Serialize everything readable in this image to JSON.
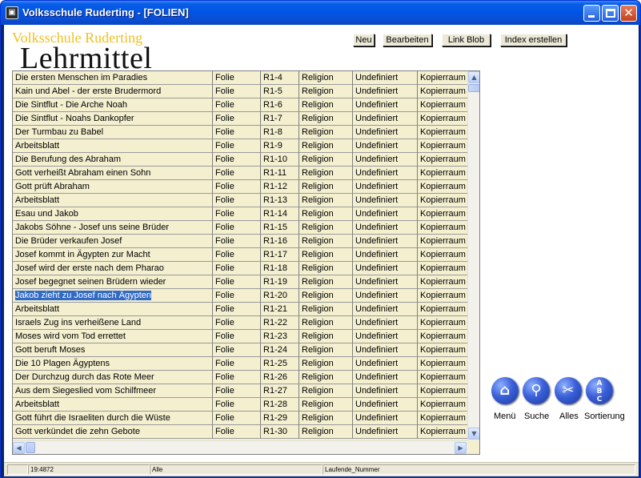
{
  "window": {
    "title": "Volksschule Ruderting - [FOLIEN]",
    "app_icon": "access-form-icon"
  },
  "brand": {
    "school": "Volksschule Ruderting",
    "heading": "Lehrmittel"
  },
  "toolbar": {
    "new_label": "Neu",
    "edit_label": "Bearbeiten",
    "link_blob_label": "Link Blob",
    "index_label": "Index erstellen"
  },
  "rows": [
    [
      "Die ersten Menschen im Paradies",
      "Folie",
      "R1-4",
      "Religion",
      "Undefiniert",
      "Kopierraum"
    ],
    [
      "Kain und Abel - der erste Brudermord",
      "Folie",
      "R1-5",
      "Religion",
      "Undefiniert",
      "Kopierraum"
    ],
    [
      "Die Sintflut - Die Arche Noah",
      "Folie",
      "R1-6",
      "Religion",
      "Undefiniert",
      "Kopierraum"
    ],
    [
      "Die Sintflut - Noahs Dankopfer",
      "Folie",
      "R1-7",
      "Religion",
      "Undefiniert",
      "Kopierraum"
    ],
    [
      "Der Turmbau zu Babel",
      "Folie",
      "R1-8",
      "Religion",
      "Undefiniert",
      "Kopierraum"
    ],
    [
      "Arbeitsblatt",
      "Folie",
      "R1-9",
      "Religion",
      "Undefiniert",
      "Kopierraum"
    ],
    [
      "Die Berufung des Abraham",
      "Folie",
      "R1-10",
      "Religion",
      "Undefiniert",
      "Kopierraum"
    ],
    [
      "Gott verheißt Abraham einen Sohn",
      "Folie",
      "R1-11",
      "Religion",
      "Undefiniert",
      "Kopierraum"
    ],
    [
      "Gott prüft Abraham",
      "Folie",
      "R1-12",
      "Religion",
      "Undefiniert",
      "Kopierraum"
    ],
    [
      "Arbeitsblatt",
      "Folie",
      "R1-13",
      "Religion",
      "Undefiniert",
      "Kopierraum"
    ],
    [
      "Esau und Jakob",
      "Folie",
      "R1-14",
      "Religion",
      "Undefiniert",
      "Kopierraum"
    ],
    [
      "Jakobs Söhne - Josef uns seine Brüder",
      "Folie",
      "R1-15",
      "Religion",
      "Undefiniert",
      "Kopierraum"
    ],
    [
      "Die Brüder verkaufen Josef",
      "Folie",
      "R1-16",
      "Religion",
      "Undefiniert",
      "Kopierraum"
    ],
    [
      "Josef kommt in Ägypten zur Macht",
      "Folie",
      "R1-17",
      "Religion",
      "Undefiniert",
      "Kopierraum"
    ],
    [
      "Josef wird der erste nach dem Pharao",
      "Folie",
      "R1-18",
      "Religion",
      "Undefiniert",
      "Kopierraum"
    ],
    [
      "Josef begegnet seinen Brüdern wieder",
      "Folie",
      "R1-19",
      "Religion",
      "Undefiniert",
      "Kopierraum"
    ],
    [
      "Jakob zieht zu Josef nach Ägypten",
      "Folie",
      "R1-20",
      "Religion",
      "Undefiniert",
      "Kopierraum"
    ],
    [
      "Arbeitsblatt",
      "Folie",
      "R1-21",
      "Religion",
      "Undefiniert",
      "Kopierraum"
    ],
    [
      "Israels Zug ins verheißene Land",
      "Folie",
      "R1-22",
      "Religion",
      "Undefiniert",
      "Kopierraum"
    ],
    [
      "Moses wird vom Tod errettet",
      "Folie",
      "R1-23",
      "Religion",
      "Undefiniert",
      "Kopierraum"
    ],
    [
      "Gott beruft Moses",
      "Folie",
      "R1-24",
      "Religion",
      "Undefiniert",
      "Kopierraum"
    ],
    [
      "Die 10 Plagen Ägyptens",
      "Folie",
      "R1-25",
      "Religion",
      "Undefiniert",
      "Kopierraum"
    ],
    [
      "Der Durchzug durch das Rote Meer",
      "Folie",
      "R1-26",
      "Religion",
      "Undefiniert",
      "Kopierraum"
    ],
    [
      "Aus dem Siegeslied vom Schilfmeer",
      "Folie",
      "R1-27",
      "Religion",
      "Undefiniert",
      "Kopierraum"
    ],
    [
      "Arbeitsblatt",
      "Folie",
      "R1-28",
      "Religion",
      "Undefiniert",
      "Kopierraum"
    ],
    [
      "Gott führt die Israeliten durch die Wüste",
      "Folie",
      "R1-29",
      "Religion",
      "Undefiniert",
      "Kopierraum"
    ],
    [
      "Gott verkündet die zehn Gebote",
      "Folie",
      "R1-30",
      "Religion",
      "Undefiniert",
      "Kopierraum"
    ]
  ],
  "selected_row": 16,
  "nav": [
    {
      "label": "Menü",
      "icon": "home-icon",
      "glyph": "⌂"
    },
    {
      "label": "Suche",
      "icon": "search-icon",
      "glyph": "⚲"
    },
    {
      "label": "Alles",
      "icon": "scissors-icon",
      "glyph": "✂"
    },
    {
      "label": "Sortierung",
      "icon": "sort-abc-icon",
      "glyph": "ABC"
    }
  ],
  "status": {
    "record": "19:4872",
    "filter": "Alle",
    "sort_field": "Laufende_Nummer"
  },
  "colors": {
    "title_bar": "#0055e5",
    "grid_bg": "#f3efcf",
    "selection": "#316ac5",
    "brand_accent": "#f0c020"
  }
}
